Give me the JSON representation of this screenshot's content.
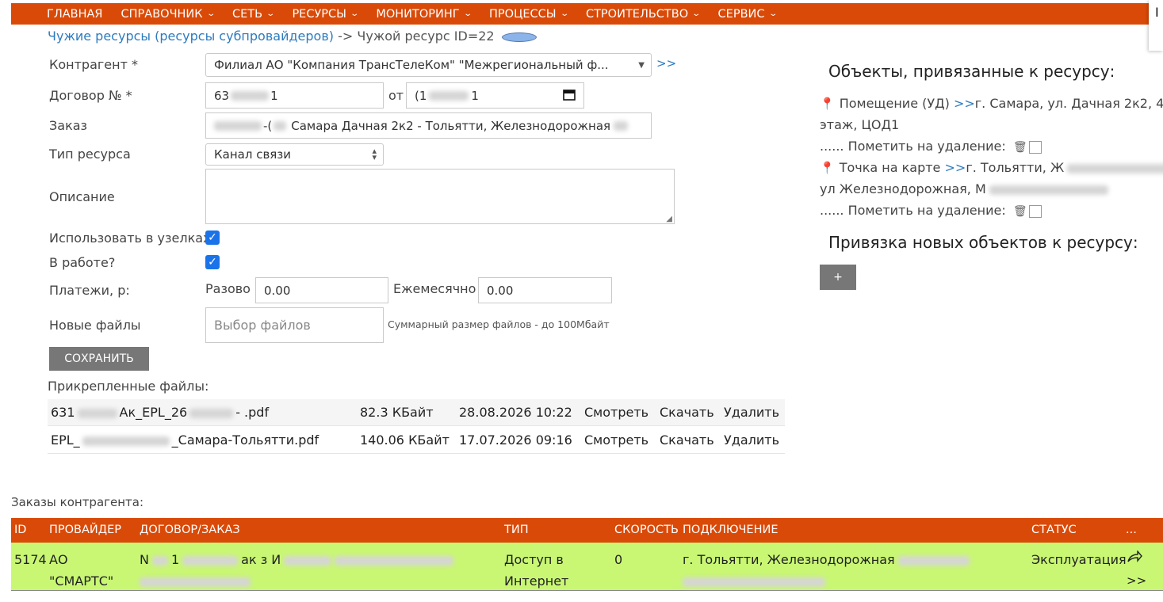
{
  "nav": {
    "items": [
      {
        "label": "ГЛАВНАЯ",
        "dropdown": false
      },
      {
        "label": "СПРАВОЧНИК",
        "dropdown": true
      },
      {
        "label": "СЕТЬ",
        "dropdown": true
      },
      {
        "label": "РЕСУРСЫ",
        "dropdown": true
      },
      {
        "label": "МОНИТОРИНГ",
        "dropdown": true
      },
      {
        "label": "ПРОЦЕССЫ",
        "dropdown": true
      },
      {
        "label": "СТРОИТЕЛЬСТВО",
        "dropdown": true
      },
      {
        "label": "СЕРВИС",
        "dropdown": true
      }
    ],
    "corner_char": "I"
  },
  "breadcrumb": {
    "link": "Чужие ресурсы (ресурсы субпровайдеров)",
    "separator": "->",
    "current": "Чужой ресурс ID=22"
  },
  "form": {
    "contractor_label": "Контрагент *",
    "contractor_value": "Филиал АО \"Компания ТрансТелеКом\" \"Межрегиональный ф...",
    "contractor_link": ">>",
    "contract_label": "Договор № *",
    "contract_value_start": "63",
    "contract_value_end": "1",
    "from_label": "от",
    "date_prefix": "(1",
    "date_mid": "1",
    "order_label": "Заказ",
    "order_value": "Самара Дачная 2к2 - Тольятти, Железнодорожная",
    "order_prefix": "-(",
    "type_label": "Тип ресурса",
    "type_value": "Канал связи",
    "desc_label": "Описание",
    "nodes_label": "Использовать в узелках",
    "inwork_label": "В работе?",
    "payments_label": "Платежи, р:",
    "once_label": "Разово",
    "once_value": "0.00",
    "monthly_label": "Ежемесячно",
    "monthly_value": "0.00",
    "newfiles_label": "Новые файлы",
    "file_choose": "Выбор файлов",
    "file_note": "Суммарный размер файлов - до 100Мбайт",
    "save_label": "СОХРАНИТЬ"
  },
  "attached": {
    "title": "Прикрепленные файлы:",
    "files": [
      {
        "name_start": "631",
        "name_mid": "Ак_EPL_26",
        "name_end": "- .pdf",
        "size": "82.3 КБайт",
        "date": "28.08.2026 10:22",
        "view": "Смотреть",
        "download": "Скачать",
        "delete": "Удалить"
      },
      {
        "name_start": "EPL_",
        "name_mid": "",
        "name_end": "_Самара-Тольятти.pdf",
        "size": "140.06 КБайт",
        "date": "17.07.2026 09:16",
        "view": "Смотреть",
        "download": "Скачать",
        "delete": "Удалить"
      }
    ]
  },
  "objects": {
    "title": "Объекты, привязанные к ресурсу:",
    "item1_type": "Помещение (УД)",
    "item1_link": ">>",
    "item1_addr": "г. Самара, ул. Дачная 2к2, 4",
    "item1_addr2": "этаж, ЦОД1",
    "mark_label": "...... Пометить на удаление:",
    "item2_type": "Точка на карте",
    "item2_link": ">>",
    "item2_addr": "г. Тольятти, Ж",
    "item2_addr2": "ул Железнодорожная, М",
    "bind_title": "Привязка новых объектов к ресурсу:",
    "plus_label": "+"
  },
  "orders": {
    "title": "Заказы контрагента:",
    "headers": [
      "ID",
      "ПРОВАЙДЕР",
      "ДОГОВОР/ЗАКАЗ",
      "ТИП",
      "СКОРОСТЬ",
      "ПОДКЛЮЧЕНИЕ",
      "СТАТУС",
      "..."
    ],
    "row": {
      "id": "5174",
      "provider_1": "АО",
      "provider_2": "\"СМАРТС\"",
      "contract_a": "N",
      "contract_b": "1",
      "contract_c": "ак з И",
      "type_1": "Доступ в",
      "type_2": "Интернет",
      "speed": "0",
      "conn": "г. Тольятти, Железнодорожная",
      "status": "Эксплуатация",
      "open_icon": "share-arrow-icon",
      "more": ">>"
    }
  }
}
